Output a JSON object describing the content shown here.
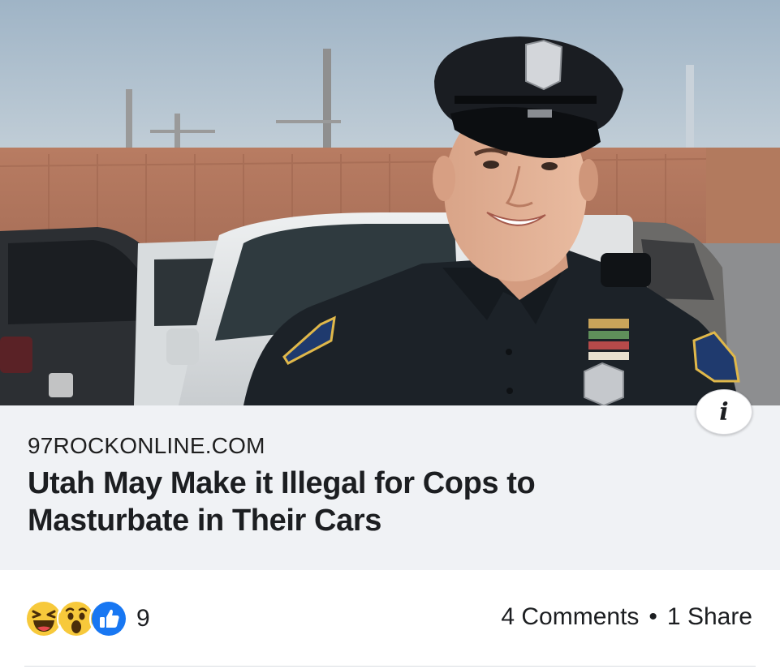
{
  "link_preview": {
    "image_alt": "Smiling police officer in uniform and cap standing in a parking lot",
    "domain": "97ROCKONLINE.COM",
    "headline": "Utah May Make it Illegal for Cops to Masturbate in Their Cars",
    "info_icon": "info-icon",
    "info_glyph": "i"
  },
  "engagement": {
    "reactions": [
      "haha-reaction-icon",
      "wow-reaction-icon",
      "like-reaction-icon"
    ],
    "reaction_count": "9",
    "comments": "4 Comments",
    "separator": "•",
    "shares": "1 Share"
  },
  "colors": {
    "link_bg": "#f0f2f5",
    "like_blue": "#1877f2",
    "emoji_yellow": "#f7c93b"
  }
}
